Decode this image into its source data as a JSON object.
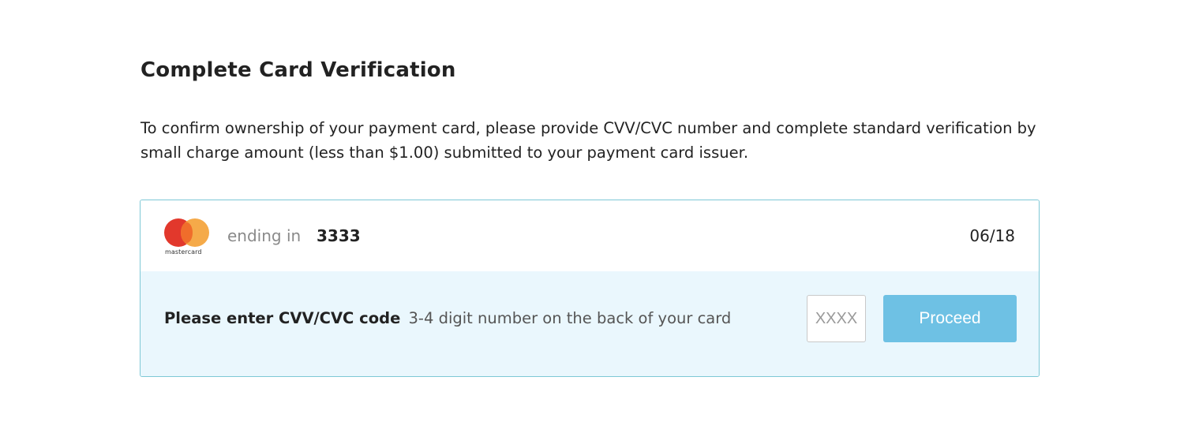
{
  "heading": "Complete Card Verification",
  "description": "To confirm ownership of your payment card, please provide CVV/CVC number and complete standard verification by small charge amount (less than $1.00) submitted to your payment card issuer.",
  "card": {
    "brand": "mastercard",
    "brand_icon": "mastercard-logo",
    "ending_label": "ending in",
    "last4": "3333",
    "expiry": "06/18"
  },
  "cvv": {
    "label": "Please enter CVV/CVC code",
    "hint": "3-4 digit number on the back of your card",
    "value": "",
    "placeholder": "XXXX"
  },
  "proceed_label": "Proceed",
  "colors": {
    "panel_border": "#7ec8d6",
    "cvv_row_background": "#eaf7fd",
    "button": "#6ec1e4",
    "mastercard_red": "#e2382c",
    "mastercard_orange": "#f4a33a"
  }
}
